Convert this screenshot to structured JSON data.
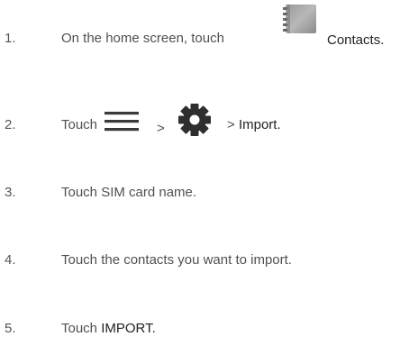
{
  "steps": [
    {
      "number": "1.",
      "text_before": "On the home screen, touch",
      "icon": "contacts-app-icon",
      "text_after": "Contacts."
    },
    {
      "number": "2.",
      "text_before": "Touch",
      "icon1": "menu-icon",
      "separator1": ">",
      "icon2": "settings-gear-icon",
      "separator2": ">",
      "text_after": "Import."
    },
    {
      "number": "3.",
      "text": "Touch SIM card name."
    },
    {
      "number": "4.",
      "text": "Touch the contacts you want to import."
    },
    {
      "number": "5.",
      "text_before": "Touch",
      "text_bold": "IMPORT."
    }
  ],
  "colors": {
    "text": "#505050",
    "emphasis": "#222222",
    "icon": "#3a3a3a"
  }
}
